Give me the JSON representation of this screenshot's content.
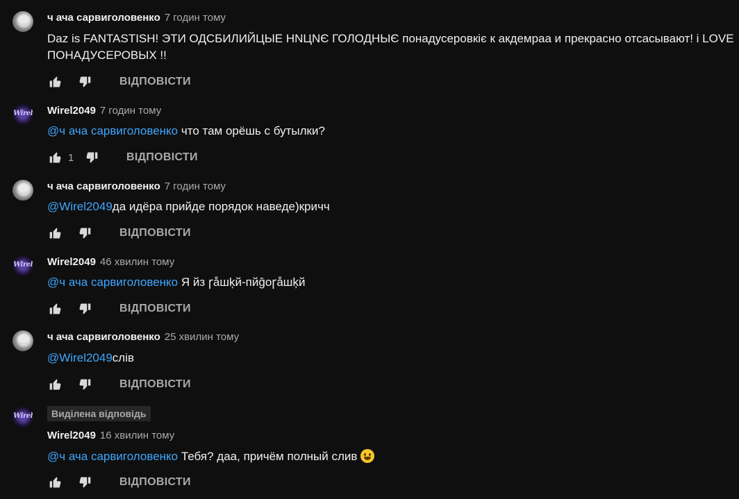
{
  "colors": {
    "background": "#0f0f0f",
    "mention": "#3ea6ff",
    "muted": "#aaaaaa"
  },
  "reply_label": "ВІДПОВІСТИ",
  "comments": [
    {
      "author": "ч ача сарвиголовенко",
      "time": "7 годин тому",
      "avatar": "user-photo-avatar",
      "text": "Daz is FANTASTISH! ЭТИ ОДСБИЛИЙЦЫЕ HNЦNЄ ГОЛОДНЫЄ понадусеровкіє к акдемраа и прекрасно отсасывают! i LOVE ПОНАДУСЕРОВЫХ !!"
    },
    {
      "author": "Wirel2049",
      "time": "7 годин тому",
      "avatar": "wirel-avatar",
      "mention": "@ч ача сарвиголовенко",
      "text": " что там орёшь с бутылки?",
      "likes": "1"
    },
    {
      "author": "ч ача сарвиголовенко",
      "time": "7 годин тому",
      "avatar": "user-photo-avatar",
      "mention": "@Wirel2049",
      "text": "да идёра прийде порядок наведе)кричч"
    },
    {
      "author": "Wirel2049",
      "time": "46 хвилин тому",
      "avatar": "wirel-avatar",
      "mention": "@ч ача сарвиголовенко",
      "text": " Я йз ꞅåшķй-пйĝоꞅåшķй"
    },
    {
      "author": "ч ача сарвиголовенко",
      "time": "25 хвилин тому",
      "avatar": "user-photo-avatar",
      "mention": "@Wirel2049",
      "text": "слів"
    },
    {
      "badge": "Виділена відповідь",
      "author": "Wirel2049",
      "time": "16 хвилин тому",
      "avatar": "wirel-avatar",
      "mention": "@ч ача сарвиголовенко",
      "text": " Тебя? даа, причём полный слив ",
      "emoji": "grinning-face-emoji"
    }
  ]
}
